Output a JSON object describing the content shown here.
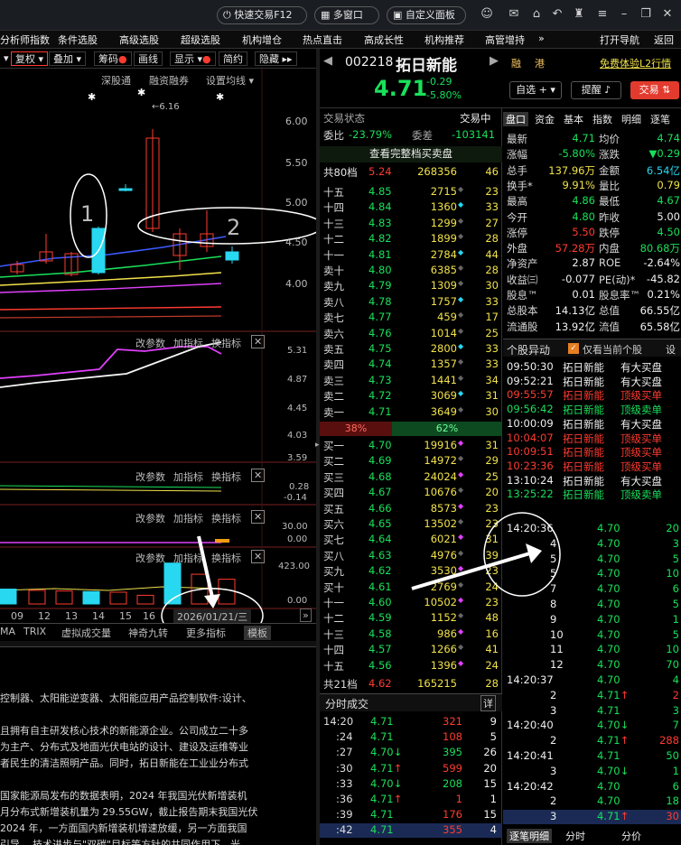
{
  "titlebar": {
    "quick_trade": "快速交易F12",
    "multi_window": "多窗口",
    "custom_panel": "自定义面板"
  },
  "menu": [
    "分析师指数",
    "条件选股",
    "高级选股",
    "超级选股",
    "机构增仓",
    "热点直击",
    "高成长性",
    "机构推荐",
    "高管增持",
    "»",
    "打开导航",
    "返回"
  ],
  "toolbar": [
    "复权",
    "叠加",
    "筹码",
    "画线",
    "显示",
    "简约",
    "隐藏"
  ],
  "chart_sub": [
    "深股通",
    "融资融券",
    "设置均线"
  ],
  "annotations": {
    "one": "1",
    "two": "2",
    "high_label": "6.16"
  },
  "price_axis": [
    "6.00",
    "5.50",
    "5.00",
    "4.50",
    "4.00"
  ],
  "indicator_panel1": {
    "buttons": [
      "改参数",
      "加指标",
      "换指标"
    ],
    "axis": [
      "5.31",
      "4.87",
      "4.45",
      "4.03",
      "3.59"
    ]
  },
  "indicator_panel2": {
    "buttons": [
      "改参数",
      "加指标",
      "换指标"
    ],
    "axis": [
      "0.28",
      "-0.14"
    ]
  },
  "indicator_panel3": {
    "buttons": [
      "改参数",
      "加指标",
      "换指标"
    ],
    "axis": [
      "30.00",
      "0.00"
    ]
  },
  "indicator_panel4": {
    "buttons": [
      "改参数",
      "加指标",
      "换指标"
    ],
    "axis": [
      "423.00",
      "0.00"
    ]
  },
  "x_dates": [
    "09",
    "12",
    "13",
    "14",
    "15",
    "16"
  ],
  "date_box": "2026/01/21/三",
  "bottom_tabs": [
    "MA",
    "TRIX",
    "虚拟成交量",
    "神奇九转",
    "更多指标",
    "模板"
  ],
  "news_lines": [
    "控制器、太阳能逆变器、太阳能应用产品控制软件:设计、",
    "",
    "且拥有自主研发核心技术的新能源企业。公司成立二十多",
    "为主产、分布式及地面光伏电站的设计、建设及运维等业",
    "者民生的清洁照明产品。同时，拓日新能在工业业分布式",
    "",
    "国家能源局发布的数据表明，2024 年我国光伏新增装机",
    "月分布式新增装机量为 29.55GW，截止报告期末我国光伏",
    "2024 年，一方面国内新增装机增速放缓，另一方面我国",
    "引导... 技术进步与\"双碳\"目标等方针的共同作用下，光"
  ],
  "stock": {
    "code": "002218",
    "name": "拓日新能",
    "price": "4.71",
    "change": "-0.29",
    "change_pct": "-5.80%",
    "tags": [
      "融",
      "港"
    ],
    "l2_link": "免费体验L2行情",
    "btn_watch": "自选",
    "btn_alert": "提醒",
    "btn_trade": "交易"
  },
  "orderbook": {
    "title": "交易状态",
    "status": "交易中",
    "webi_label": "委比",
    "webi": "-23.79%",
    "weicha_label": "委差",
    "weicha": "-103141",
    "full_label": "查看完整档买卖盘",
    "top_label": "共80档",
    "top_price": "5.24",
    "top_vol": "268356",
    "top_cnt": "46",
    "asks": [
      [
        "十五",
        "4.85",
        "2715",
        "23"
      ],
      [
        "十四",
        "4.84",
        "1360",
        "33"
      ],
      [
        "十三",
        "4.83",
        "1299",
        "27"
      ],
      [
        "十二",
        "4.82",
        "1899",
        "28"
      ],
      [
        "十一",
        "4.81",
        "2784",
        "44"
      ],
      [
        "卖十",
        "4.80",
        "6385",
        "28"
      ],
      [
        "卖九",
        "4.79",
        "1309",
        "30"
      ],
      [
        "卖八",
        "4.78",
        "1757",
        "33"
      ],
      [
        "卖七",
        "4.77",
        "459",
        "17"
      ],
      [
        "卖六",
        "4.76",
        "1014",
        "25"
      ],
      [
        "卖五",
        "4.75",
        "2800",
        "33"
      ],
      [
        "卖四",
        "4.74",
        "1357",
        "33"
      ],
      [
        "卖三",
        "4.73",
        "1441",
        "34"
      ],
      [
        "卖二",
        "4.72",
        "3069",
        "31"
      ],
      [
        "卖一",
        "4.71",
        "3649",
        "30"
      ]
    ],
    "ratio_sell": "38%",
    "ratio_buy": "62%",
    "bids": [
      [
        "买一",
        "4.70",
        "19916",
        "31"
      ],
      [
        "买二",
        "4.69",
        "14972",
        "29"
      ],
      [
        "买三",
        "4.68",
        "24024",
        "25"
      ],
      [
        "买四",
        "4.67",
        "10676",
        "20"
      ],
      [
        "买五",
        "4.66",
        "8573",
        "23"
      ],
      [
        "买六",
        "4.65",
        "13502",
        "23"
      ],
      [
        "买七",
        "4.64",
        "6021",
        "31"
      ],
      [
        "买八",
        "4.63",
        "4976",
        "39"
      ],
      [
        "买九",
        "4.62",
        "3530",
        "23"
      ],
      [
        "买十",
        "4.61",
        "2769",
        "24"
      ],
      [
        "十一",
        "4.60",
        "10502",
        "23"
      ],
      [
        "十二",
        "4.59",
        "1152",
        "48"
      ],
      [
        "十三",
        "4.58",
        "986",
        "16"
      ],
      [
        "十四",
        "4.57",
        "1266",
        "41"
      ],
      [
        "十五",
        "4.56",
        "1396",
        "24"
      ]
    ],
    "bottom_label": "共21档",
    "bottom_price": "4.62",
    "bottom_vol": "165215",
    "bottom_cnt": "28",
    "fenshi_title": "分时成交",
    "fenshi_btn": "详",
    "fenshi": [
      [
        "14:20",
        "4.71",
        "",
        "321",
        "9"
      ],
      [
        ":24",
        "4.71",
        "",
        "108",
        "5"
      ],
      [
        ":27",
        "4.70",
        "↓",
        "395",
        "26"
      ],
      [
        ":30",
        "4.71",
        "↑",
        "599",
        "20"
      ],
      [
        ":33",
        "4.70",
        "↓",
        "208",
        "15"
      ],
      [
        ":36",
        "4.71",
        "↑",
        "1",
        "1"
      ],
      [
        ":39",
        "4.71",
        "",
        "176",
        "15"
      ],
      [
        ":42",
        "4.71",
        "",
        "355",
        "4"
      ]
    ]
  },
  "rightpanel": {
    "tabs": [
      "盘口",
      "资金",
      "基本",
      "指数",
      "明细",
      "逐笔"
    ],
    "data": [
      [
        "最新",
        "4.71",
        "均价",
        "4.74"
      ],
      [
        "涨幅",
        "-5.80%",
        "涨跌",
        "▼0.29"
      ],
      [
        "总手",
        "137.96万",
        "金额",
        "6.54亿"
      ],
      [
        "换手*",
        "9.91%",
        "量比",
        "0.79"
      ],
      [
        "最高",
        "4.86",
        "最低",
        "4.67"
      ],
      [
        "今开",
        "4.80",
        "昨收",
        "5.00"
      ],
      [
        "涨停",
        "5.50",
        "跌停",
        "4.50"
      ],
      [
        "外盘",
        "57.28万",
        "内盘",
        "80.68万"
      ],
      [
        "净资产",
        "2.87",
        "ROE",
        "-2.64%"
      ],
      [
        "收益㈢",
        "-0.077",
        "PE(动)*",
        "-45.82"
      ],
      [
        "股息™",
        "0.01",
        "股息率™",
        "0.21%"
      ],
      [
        "总股本",
        "14.13亿",
        "总值",
        "66.55亿"
      ],
      [
        "流通股",
        "13.92亿",
        "流值",
        "65.58亿"
      ]
    ],
    "alerts_title": "个股异动",
    "alerts_check": "仅看当前个股",
    "alerts_btn": "设",
    "alerts": [
      [
        "09:50:30",
        "拓日新能",
        "有大买盘"
      ],
      [
        "09:52:21",
        "拓日新能",
        "有大买盘"
      ],
      [
        "09:55:57",
        "拓日新能",
        "顶级买单"
      ],
      [
        "09:56:42",
        "拓日新能",
        "顶级卖单"
      ],
      [
        "10:00:09",
        "拓日新能",
        "有大买盘"
      ],
      [
        "10:04:07",
        "拓日新能",
        "顶级买单"
      ],
      [
        "10:09:51",
        "拓日新能",
        "顶级买单"
      ],
      [
        "10:23:36",
        "拓日新能",
        "顶级买单"
      ],
      [
        "13:10:24",
        "拓日新能",
        "有大买盘"
      ],
      [
        "13:25:22",
        "拓日新能",
        "顶级卖单"
      ]
    ],
    "ticks": [
      [
        "14:20:36",
        "4.70",
        "",
        "20"
      ],
      [
        "4",
        "4.70",
        "",
        "3"
      ],
      [
        "5",
        "4.70",
        "",
        "5"
      ],
      [
        "5",
        "4.70",
        "",
        "10"
      ],
      [
        "7",
        "4.70",
        "",
        "6"
      ],
      [
        "8",
        "4.70",
        "",
        "5"
      ],
      [
        "9",
        "4.70",
        "",
        "1"
      ],
      [
        "10",
        "4.70",
        "",
        "5"
      ],
      [
        "11",
        "4.70",
        "",
        "10"
      ],
      [
        "12",
        "4.70",
        "",
        "70"
      ],
      [
        "14:20:37",
        "4.70",
        "",
        "4"
      ],
      [
        "2",
        "4.71",
        "↑",
        "2"
      ],
      [
        "3",
        "4.71",
        "",
        "3"
      ],
      [
        "14:20:40",
        "4.70",
        "↓",
        "7"
      ],
      [
        "2",
        "4.71",
        "↑",
        "288"
      ],
      [
        "14:20:41",
        "4.71",
        "",
        "50"
      ],
      [
        "3",
        "4.70",
        "↓",
        "1"
      ],
      [
        "14:20:42",
        "4.70",
        "",
        "6"
      ],
      [
        "2",
        "4.70",
        "",
        "18"
      ],
      [
        "3",
        "4.71",
        "↑",
        "30"
      ]
    ],
    "bottom_tabs": [
      "逐笔明细",
      "分时",
      "分价"
    ]
  },
  "chart_data": {
    "type": "candlestick",
    "price_axis": {
      "ticks": [
        6.0,
        5.5,
        5.0,
        4.5,
        4.0
      ],
      "range": [
        3.6,
        6.35
      ]
    },
    "candles": [
      {
        "x": "08",
        "o": 4.66,
        "c": 4.6,
        "h": 4.69,
        "l": 4.57
      },
      {
        "x": "09",
        "o": 4.58,
        "c": 4.66,
        "h": 4.7,
        "l": 4.55
      },
      {
        "x": "12",
        "o": 4.7,
        "c": 4.8,
        "h": 5.0,
        "l": 4.67
      },
      {
        "x": "13",
        "o": 4.55,
        "c": 4.78,
        "h": 4.8,
        "l": 4.53
      },
      {
        "x": "14",
        "o": 5.06,
        "c": 4.57,
        "h": 5.08,
        "l": 4.55
      },
      {
        "x": "15",
        "o": 5.5,
        "c": 5.49,
        "h": 5.55,
        "l": 5.47
      },
      {
        "x": "16",
        "o": 5.06,
        "c": 6.06,
        "h": 6.16,
        "l": 5.02
      },
      {
        "x": "19",
        "o": 4.76,
        "c": 5.0,
        "h": 5.06,
        "l": 4.6
      },
      {
        "x": "20",
        "o": 4.86,
        "c": 5.0,
        "h": 5.26,
        "l": 4.8
      },
      {
        "x": "21",
        "o": 4.8,
        "c": 4.71,
        "h": 4.86,
        "l": 4.67
      }
    ],
    "volumes": [
      {
        "x": "08",
        "v": 120,
        "up": false
      },
      {
        "x": "09",
        "v": 110,
        "up": true
      },
      {
        "x": "12",
        "v": 105,
        "up": true
      },
      {
        "x": "13",
        "v": 100,
        "up": false
      },
      {
        "x": "14",
        "v": 95,
        "up": true
      },
      {
        "x": "15",
        "v": 70,
        "up": true
      },
      {
        "x": "16",
        "v": 330,
        "up": false
      },
      {
        "x": "19",
        "v": 240,
        "up": true
      },
      {
        "x": "20",
        "v": 200,
        "up": true
      },
      {
        "x": "21",
        "v": 138,
        "up": false
      }
    ],
    "volume_range": [
      0,
      423
    ]
  }
}
